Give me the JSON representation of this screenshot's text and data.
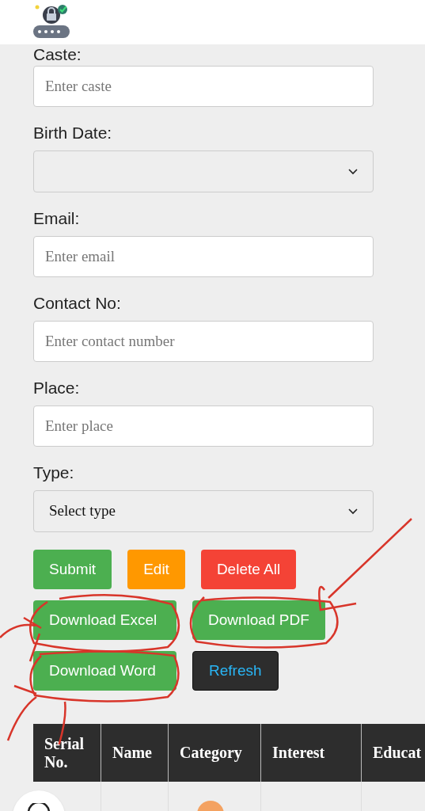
{
  "form": {
    "fields": [
      {
        "label": "Caste:",
        "kind": "text",
        "placeholder": "Enter caste"
      },
      {
        "label": "Birth Date:",
        "kind": "select"
      },
      {
        "label": "Email:",
        "kind": "text",
        "placeholder": "Enter email"
      },
      {
        "label": "Contact No:",
        "kind": "text",
        "placeholder": "Enter contact number"
      },
      {
        "label": "Place:",
        "kind": "text",
        "placeholder": "Enter place"
      },
      {
        "label": "Type:",
        "kind": "select",
        "value": "Select type"
      }
    ],
    "button_rows": [
      [
        {
          "label": "Submit",
          "kind": "success"
        },
        {
          "label": "Edit",
          "kind": "warning"
        },
        {
          "label": "Delete All",
          "kind": "danger"
        }
      ],
      [
        {
          "label": "Download Excel",
          "kind": "success"
        },
        {
          "label": "Download PDF",
          "kind": "success"
        }
      ],
      [
        {
          "label": "Download Word",
          "kind": "success"
        },
        {
          "label": "Refresh",
          "kind": "dark"
        }
      ]
    ]
  },
  "table": {
    "columns": [
      "Serial No.",
      "Name",
      "Category",
      "Interest",
      "Educat"
    ]
  }
}
